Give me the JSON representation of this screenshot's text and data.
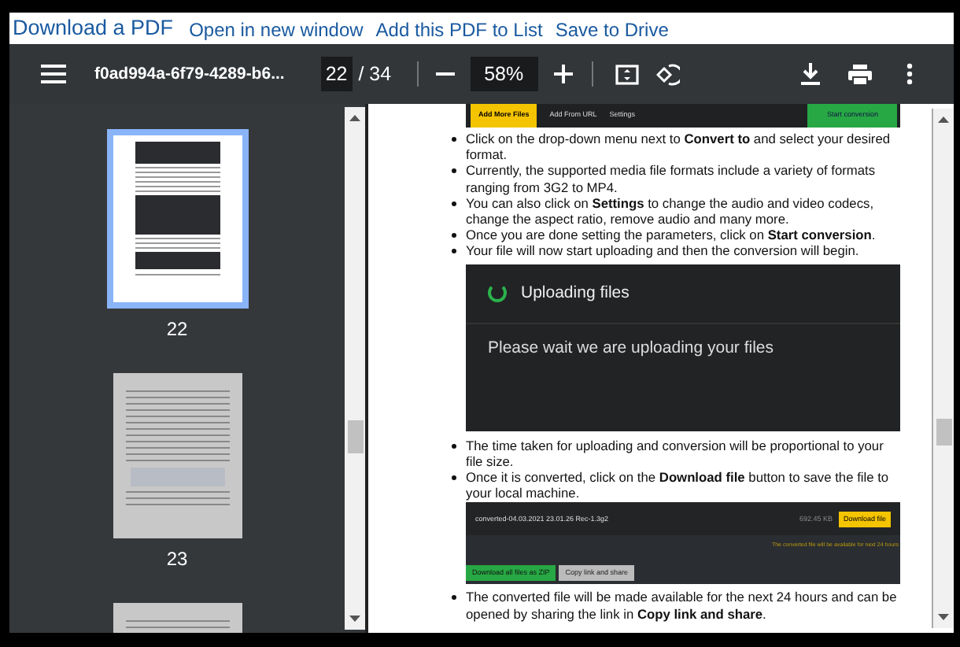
{
  "links": [
    {
      "label": "Download a PDF",
      "kind": "title"
    },
    {
      "label": "Open in new window",
      "kind": "link"
    },
    {
      "label": "Add this PDF to List",
      "kind": "link"
    },
    {
      "label": "Save to Drive",
      "kind": "link"
    }
  ],
  "toolbar": {
    "filename": "f0ad994a-6f79-4289-b6...",
    "page": "22",
    "page_total": "/ 34",
    "zoom": "58%"
  },
  "sidebar": {
    "thumbnails": [
      {
        "label": "22",
        "selected": true
      },
      {
        "label": "23",
        "selected": false
      },
      {
        "selected": false
      }
    ]
  },
  "document": {
    "blocks": [
      {
        "kind": "converter_toolbar",
        "buttons": [
          "Add More Files",
          "Add From URL",
          "Settings"
        ],
        "action": "Start conversion"
      },
      {
        "kind": "bullet",
        "text": "Click on the drop-down menu next to **Convert to** and select your desired format."
      },
      {
        "kind": "bullet",
        "text": "Currently, the supported media file formats include a variety of formats ranging from 3G2 to MP4."
      },
      {
        "kind": "bullet",
        "text": "You can also click on **Settings** to change the audio and video codecs, change the aspect ratio, remove audio and many more."
      },
      {
        "kind": "bullet",
        "text": "Once you are done setting the parameters, click on **Start conversion**."
      },
      {
        "kind": "bullet",
        "text": "Your file will now start uploading and then the conversion will begin."
      },
      {
        "kind": "upload_panel",
        "title": "Uploading files",
        "message": "Please wait we are uploading your files"
      },
      {
        "kind": "bullet",
        "text": "The time taken for uploading and conversion will be proportional to your file size."
      },
      {
        "kind": "bullet",
        "text": "Once it is converted, click on the **Download file** button to save the file to your local machine."
      },
      {
        "kind": "file_panel",
        "filename": "converted-04.03.2021 23.01.26 Rec-1.3g2",
        "size": "692.45 KB",
        "download": "Download file",
        "note": "The converted file will be available for next 24 hours",
        "zip": "Download all files as ZIP",
        "share": "Copy link and share"
      },
      {
        "kind": "bullet",
        "text": "The converted file will be made available for the next 24 hours and can be opened by sharing the link in **Copy link and share**."
      }
    ]
  }
}
